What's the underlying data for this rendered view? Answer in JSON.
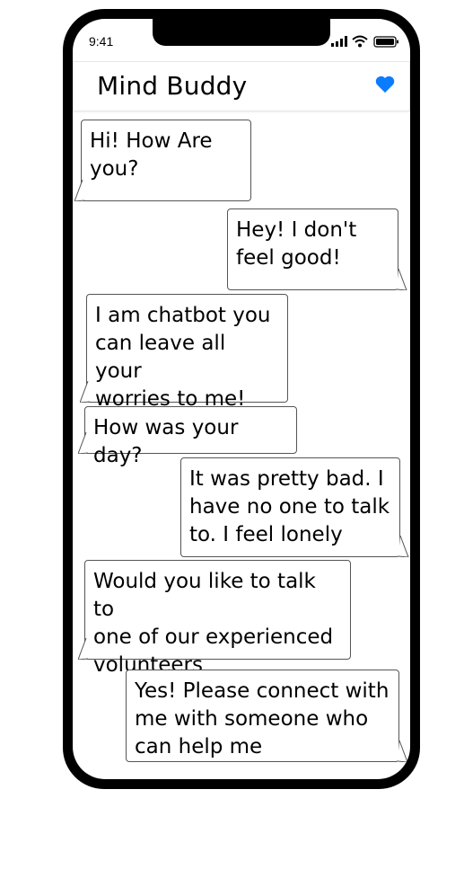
{
  "status_bar": {
    "time": "9:41"
  },
  "header": {
    "title": "Mind Buddy",
    "favorite_icon": "heart-icon",
    "accent_color": "#0a7cff"
  },
  "messages": [
    {
      "sender": "bot",
      "text": "Hi! How Are you?"
    },
    {
      "sender": "user",
      "text": "Hey! I don't feel good!"
    },
    {
      "sender": "bot",
      "text": "I am chatbot you can leave all your worries to me!"
    },
    {
      "sender": "bot",
      "text": "How was your day?"
    },
    {
      "sender": "user",
      "text": "It was pretty bad. I have no one to talk to. I feel lonely"
    },
    {
      "sender": "bot",
      "text": "Would you like to talk to one of our experienced volunteers"
    },
    {
      "sender": "user",
      "text": "Yes! Please connect with me with someone who can help me"
    }
  ]
}
